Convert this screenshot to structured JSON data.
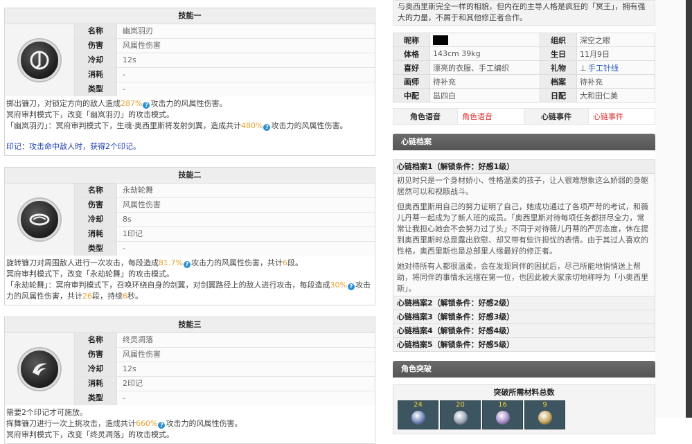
{
  "skills": [
    {
      "header": "技能一",
      "labels": {
        "name": "名称",
        "damage": "伤害",
        "cooldown": "冷却",
        "cost": "消耗",
        "type": "类型"
      },
      "values": {
        "name": "幽岚羽刃",
        "damage": "风属性伤害",
        "cooldown": "12s",
        "cost": "-",
        "type": "-"
      },
      "icon": "scythe-slash-icon",
      "desc_l1_a": "掷出镰刀，对锁定方向的敌人造成",
      "desc_l1_pct": "287%",
      "desc_l1_b": "攻击力的风属性伤害。",
      "desc_l2": "冥府审判模式下，改变「幽岚羽刃」的攻击模式。",
      "desc_l3_a": "「幽岚羽刃」：冥府审判模式下，生魂·奥西里斯将发射剑翼，造成共计",
      "desc_l3_pct": "480%",
      "desc_l3_b": "攻击力的风属性伤害。",
      "mark": "印记：攻击命中敌人时，获得2个印记。"
    },
    {
      "header": "技能二",
      "labels": {
        "name": "名称",
        "damage": "伤害",
        "cooldown": "冷却",
        "cost": "消耗",
        "type": "类型"
      },
      "values": {
        "name": "永劫轮舞",
        "damage": "风属性伤害",
        "cooldown": "8s",
        "cost": "1印记",
        "type": "-"
      },
      "icon": "spinning-blade-icon",
      "desc_l1_a": "旋转镰刀对周围敌人进行一次攻击，每段造成",
      "desc_l1_pct": "81.7%",
      "desc_l1_b": "攻击力的风属性伤害，共计",
      "desc_l1_n": "6",
      "desc_l1_c": "段。",
      "desc_l2": "冥府审判模式下，改变「永劫轮舞」的攻击模式。",
      "desc_l3_a": "「永劫轮舞」：冥府审判模式下，召唤环绕自身的剑翼，对剑翼路径上的敌人进行攻击，每段造成",
      "desc_l3_pct": "30%",
      "desc_l3_b": "攻击力的风属性伤害，共计",
      "desc_l3_n": "26",
      "desc_l3_c": "段，持续",
      "desc_l3_n2": "6",
      "desc_l3_d": "秒。"
    },
    {
      "header": "技能三",
      "labels": {
        "name": "名称",
        "damage": "伤害",
        "cooldown": "冷却",
        "cost": "消耗",
        "type": "类型"
      },
      "values": {
        "name": "终灵凋落",
        "damage": "风属性伤害",
        "cooldown": "12s",
        "cost": "2印记",
        "type": "-"
      },
      "icon": "wing-sweep-icon",
      "desc_l1": "需要2个印记才可施放。",
      "desc_l2_a": "挥舞镰刀进行一次上挑攻击，造成共计",
      "desc_l2_pct": "660%",
      "desc_l2_b": "攻击力的风属性伤害。",
      "desc_l3": "冥府审判模式下，改变「终灵凋落」的攻击模式。"
    }
  ],
  "profile": {
    "intro": "与奥西里斯完全一样的相貌，但内在的主导人格是疯狂的「冥王」，拥有强大的力量，不屑于和其他修正者合作。",
    "rows": [
      {
        "k1": "昵称",
        "v1": "",
        "k2": "组织",
        "v2": "深空之眼"
      },
      {
        "k1": "体格",
        "v1": "143cm 39kg",
        "k2": "生日",
        "v2": "11月9日"
      },
      {
        "k1": "喜好",
        "v1": "漂亮的衣服、手工编织",
        "k2": "礼物",
        "v2": "手工针线"
      },
      {
        "k1": "画师",
        "v1": "待补充",
        "k2": "档案",
        "v2": "待补充"
      },
      {
        "k1": "中配",
        "v1": "邕四白",
        "k2": "日配",
        "v2": "大和田仁美"
      }
    ],
    "voice_label": "角色语音",
    "voice_link": "角色语音",
    "event_label": "心链事件",
    "event_link": "心链事件"
  },
  "heart_archive": {
    "section_title": "心链档案",
    "file1_title": "心链档案1（解锁条件：好感1级）",
    "paragraphs": [
      "初见时只是一个身材娇小、性格温柔的孩子，让人很难想象这么娇弱的身躯居然可以和视骸战斗。",
      "但奥西里斯用自己的努力证明了自己，她成功通过了各项严苛的考试，和薇儿丹蒂一起成为了新人班的成员。「奥西里斯对待每项任务都拼尽全力，常常让我担心她会不会努力过了头」不同于对待薇儿丹蒂的严厉态度，休在提到奥西里斯时总是露出欣慰、却又带有些许担忧的表情。由于其过人喜欢的性格，奥西里斯也是总部里人缘最好的修正者。",
      "她对待所有人都很温柔，会在发现同伴的困扰后，尽己所能地悄悄送上帮助，将同伴的事情永远摆在第一位，也因此被大家亲切地称呼为「小奥西里斯」。"
    ],
    "files": [
      "心链档案2（解锁条件：好感2级）",
      "心链档案3（解锁条件：好感3级）",
      "心链档案4（解锁条件：好感4级）",
      "心链档案5（解锁条件：好感5级）"
    ]
  },
  "breakthrough": {
    "section_title": "角色突破",
    "materials_title": "突破所需材料总数",
    "materials": [
      {
        "count": "24",
        "icon": "blue-orb-icon",
        "color": "#6f86b8"
      },
      {
        "count": "20",
        "icon": "silver-orb-icon",
        "color": "#9aa6b5"
      },
      {
        "count": "16",
        "icon": "violet-orb-icon",
        "color": "#a58cc7"
      },
      {
        "count": "9",
        "icon": "gold-orb-icon",
        "color": "#c7a458"
      }
    ]
  }
}
